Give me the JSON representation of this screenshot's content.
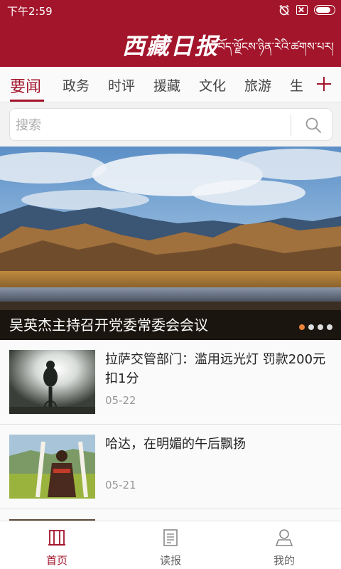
{
  "status_bar": {
    "time": "下午2:59"
  },
  "header": {
    "logo_text": "西藏日报",
    "tibetan_title": "བོད་ལྗོངས་ཉིན་རེའི་ཚགས་པར།"
  },
  "channels": {
    "tabs": [
      {
        "label": "要闻",
        "active": true
      },
      {
        "label": "政务",
        "active": false
      },
      {
        "label": "时评",
        "active": false
      },
      {
        "label": "援藏",
        "active": false
      },
      {
        "label": "文化",
        "active": false
      },
      {
        "label": "旅游",
        "active": false
      },
      {
        "label": "生",
        "active": false
      }
    ]
  },
  "search": {
    "placeholder": "搜索"
  },
  "hero": {
    "title": "吴英杰主持召开党委常委会会议",
    "slide_count": 4,
    "active_slide": 1
  },
  "news": [
    {
      "title": "拉萨交管部门：滥用远光灯 罚款200元扣1分",
      "date": "05-22"
    },
    {
      "title": "哈达，在明媚的午后飘扬",
      "date": "05-21"
    }
  ],
  "bottom_nav": {
    "items": [
      {
        "label": "首页",
        "icon": "home-book-icon",
        "active": true
      },
      {
        "label": "读报",
        "icon": "newspaper-icon",
        "active": false
      },
      {
        "label": "我的",
        "icon": "user-icon",
        "active": false
      }
    ]
  },
  "colors": {
    "brand": "#a3152b",
    "accent_dot": "#e8833a"
  }
}
